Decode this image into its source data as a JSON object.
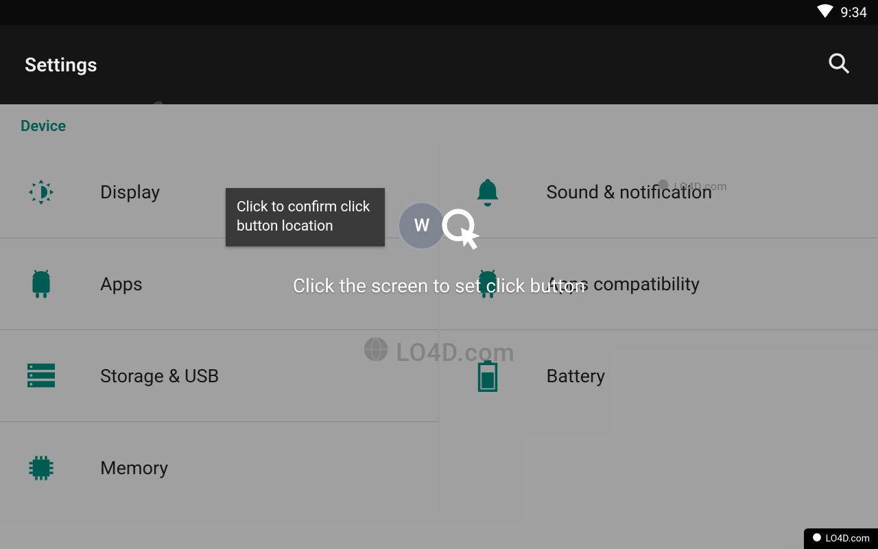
{
  "statusbar": {
    "time": "9:34"
  },
  "appbar": {
    "title": "Settings"
  },
  "section": {
    "heading": "Device"
  },
  "settings": {
    "left": [
      {
        "label": "Display"
      },
      {
        "label": "Apps"
      },
      {
        "label": "Storage & USB"
      },
      {
        "label": "Memory"
      }
    ],
    "right": [
      {
        "label": "Sound & notification"
      },
      {
        "label": "Apps compatibility"
      },
      {
        "label": "Battery"
      }
    ]
  },
  "overlay": {
    "tooltip": "Click to confirm click button location",
    "avatar_letter": "W",
    "instruction": "Click the screen to set click button"
  },
  "watermark": {
    "text": "LO4D.com"
  }
}
